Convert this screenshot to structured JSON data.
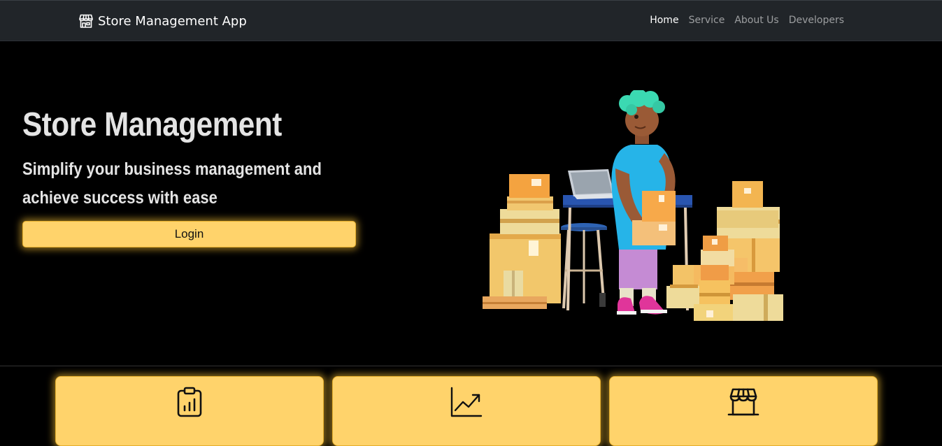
{
  "navbar": {
    "brand": "Store Management App",
    "brand_icon": "storefront-icon",
    "links": [
      {
        "label": "Home",
        "active": true
      },
      {
        "label": "Service",
        "active": false
      },
      {
        "label": "About Us",
        "active": false
      },
      {
        "label": "Developers",
        "active": false
      }
    ]
  },
  "hero": {
    "title": "Store Management",
    "subtitle": "Simplify your business management and achieve success with ease",
    "login_label": "Login",
    "illustration": "person-packing-boxes-illustration"
  },
  "features": [
    {
      "icon": "clipboard-chart-icon"
    },
    {
      "icon": "trending-up-chart-icon"
    },
    {
      "icon": "storefront-icon"
    }
  ],
  "colors": {
    "navbar_bg": "#212529",
    "page_bg": "#000000",
    "accent": "#ffd36b",
    "accent_border": "#e5ad2c",
    "hero_text": "#e4e4e4"
  }
}
